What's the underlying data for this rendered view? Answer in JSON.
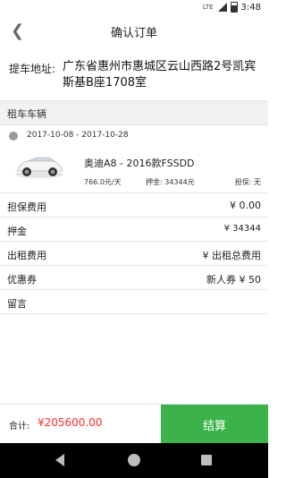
{
  "status": {
    "network": "LTE",
    "time": "3:48"
  },
  "header": {
    "back_icon": "chevron-left-icon",
    "title": "确认订单"
  },
  "pickup": {
    "label": "提车地址:",
    "address": "广东省惠州市惠城区云山西路2号凯宾斯基B座1708室"
  },
  "section": {
    "title": "租车车辆"
  },
  "rental": {
    "date_range": "2017-10-08 - 2017-10-28"
  },
  "car": {
    "name": "奥迪A8 - 2016款FSSDD",
    "price": "766.0元/天",
    "deposit": "押金:  34344元",
    "insurance": "担保: 无"
  },
  "fees": [
    {
      "label": "担保费用",
      "value": "¥ 0.00"
    },
    {
      "label": "押金",
      "value": "¥ 34344"
    },
    {
      "label": "出租费用",
      "value": "¥ 出租总费用"
    },
    {
      "label": "优惠券",
      "value": "新人券 ¥ 50"
    },
    {
      "label": "留言",
      "value": ""
    }
  ],
  "footer": {
    "total_label": "合计:",
    "total_value": "¥205600.00",
    "checkout_label": "结算"
  },
  "colors": {
    "accent_green": "#3bb34a",
    "total_red": "#ff2d2d"
  }
}
